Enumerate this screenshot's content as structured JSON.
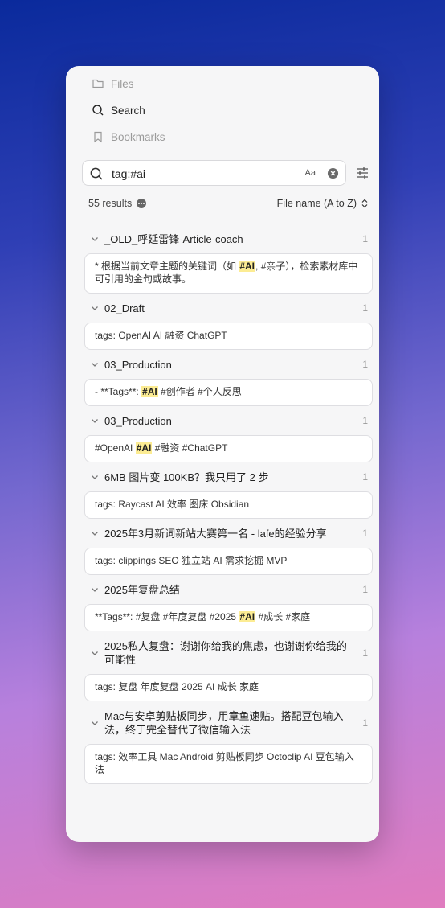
{
  "nav": [
    {
      "label": "Files",
      "icon": "folder-icon",
      "active": false
    },
    {
      "label": "Search",
      "icon": "search-icon",
      "active": true
    },
    {
      "label": "Bookmarks",
      "icon": "bookmark-icon",
      "active": false
    }
  ],
  "search": {
    "query": "tag:#ai",
    "match_case_label": "Aa"
  },
  "results": {
    "count_label": "55 results",
    "sort_label": "File name (A to Z)"
  },
  "colors": {
    "highlight": "#fcec93"
  },
  "groups": [
    {
      "title": "_OLD_呼延雷锋-Article-coach",
      "count": "1",
      "match": [
        [
          "*   根据当前文章主题的关键词（如 ",
          false
        ],
        [
          "#AI",
          true
        ],
        [
          ", #亲子），检索素材库中可引用的金句或故事。",
          false
        ]
      ]
    },
    {
      "title": "02_Draft",
      "count": "1",
      "match": [
        [
          "tags: OpenAI AI 融资 ChatGPT",
          false
        ]
      ]
    },
    {
      "title": "03_Production",
      "count": "1",
      "match": [
        [
          "- **Tags**: ",
          false
        ],
        [
          "#AI",
          true
        ],
        [
          " #创作者 #个人反思",
          false
        ]
      ]
    },
    {
      "title": "03_Production",
      "count": "1",
      "match": [
        [
          "#OpenAI ",
          false
        ],
        [
          "#AI",
          true
        ],
        [
          " #融资 #ChatGPT",
          false
        ]
      ]
    },
    {
      "title": "6MB 图片变 100KB？我只用了 2 步",
      "count": "1",
      "match": [
        [
          "tags: Raycast AI 效率 图床 Obsidian",
          false
        ]
      ]
    },
    {
      "title": "2025年3月新词新站大赛第一名 - lafe的经验分享",
      "count": "1",
      "match": [
        [
          "tags: clippings SEO 独立站 AI 需求挖掘 MVP",
          false
        ]
      ]
    },
    {
      "title": "2025年复盘总结",
      "count": "1",
      "match": [
        [
          "**Tags**: #复盘 #年度复盘 #2025 ",
          false
        ],
        [
          "#AI",
          true
        ],
        [
          " #成长 #家庭",
          false
        ]
      ]
    },
    {
      "title": "2025私人复盘：谢谢你给我的焦虑，也谢谢你给我的可能性",
      "count": "1",
      "match": [
        [
          "tags: 复盘 年度复盘 2025 AI 成长 家庭",
          false
        ]
      ]
    },
    {
      "title": "Mac与安卓剪贴板同步，用章鱼速贴。搭配豆包输入法，终于完全替代了微信输入法",
      "count": "1",
      "match": [
        [
          "tags: 效率工具 Mac Android 剪贴板同步 Octoclip AI 豆包输入法",
          false
        ]
      ]
    }
  ]
}
